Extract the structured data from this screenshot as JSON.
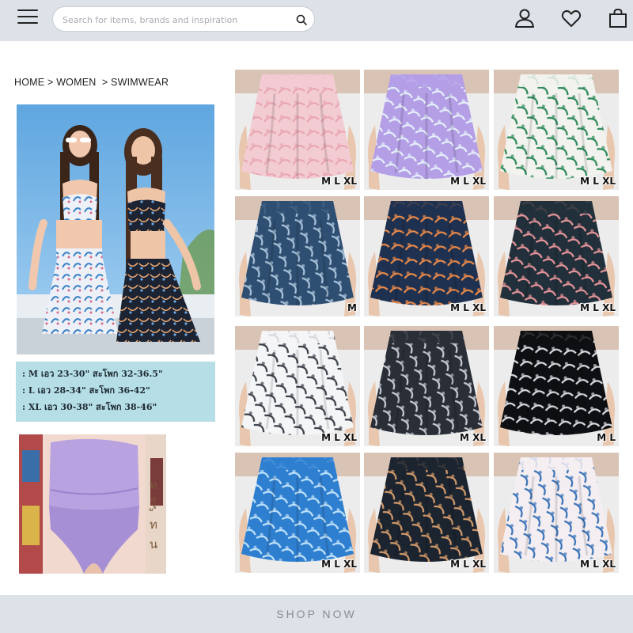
{
  "header": {
    "search_placeholder": "Search for items, brands and inspiration",
    "icons": [
      "menu-icon",
      "search-icon",
      "account-icon",
      "heart-icon",
      "bag-icon"
    ]
  },
  "breadcrumb": {
    "home": "HOME",
    "women": "WOMEN",
    "swimwear": "SWIMWEAR",
    "separator": ">"
  },
  "size_chart": [
    ": M  เอว 23-30\" สะโพก 32-36.5\"",
    ": L  เอว 28-34\" สะโพก 36-42\"",
    ": XL เอว 30-38\" สะโพก 38-46\""
  ],
  "detail_caption": "ทูโทน",
  "products": [
    {
      "sizes": "M L XL",
      "pattern": "pink-script-print",
      "colors": [
        "#f3cbd2",
        "#e9a7b3"
      ]
    },
    {
      "sizes": "M L XL",
      "pattern": "lavender-leaf-print",
      "colors": [
        "#b49ee6",
        "#e5f0fb"
      ]
    },
    {
      "sizes": "M L XL",
      "pattern": "pineapple-print",
      "colors": [
        "#f2f2ee",
        "#2e8a5a"
      ]
    },
    {
      "sizes": "M",
      "pattern": "navy-tie-dye",
      "colors": [
        "#2f4f72",
        "#a9c2da"
      ]
    },
    {
      "sizes": "M L XL",
      "pattern": "navy-tropical-leaf",
      "colors": [
        "#1f3150",
        "#e8894a"
      ]
    },
    {
      "sizes": "M L XL",
      "pattern": "dark-floral-palm",
      "colors": [
        "#21303a",
        "#e6949a"
      ]
    },
    {
      "sizes": "M L XL",
      "pattern": "white-marble",
      "colors": [
        "#f4f5f7",
        "#3a3f47"
      ]
    },
    {
      "sizes": "M  XL",
      "pattern": "grey-marble",
      "colors": [
        "#2a2e36",
        "#c5cad3"
      ]
    },
    {
      "sizes": "M L",
      "pattern": "black-marble",
      "colors": [
        "#0e0f12",
        "#d8dadf"
      ]
    },
    {
      "sizes": "M L XL",
      "pattern": "blue-tie-dye",
      "colors": [
        "#2f7fd0",
        "#bfe2fb"
      ]
    },
    {
      "sizes": "M L XL",
      "pattern": "navy-chain-print",
      "colors": [
        "#1c2430",
        "#d29a6a"
      ]
    },
    {
      "sizes": "M L XL",
      "pattern": "white-blue-chain",
      "colors": [
        "#f4eef2",
        "#3a73b8"
      ]
    }
  ],
  "footer": {
    "cta": "SHOP NOW"
  },
  "colors": {
    "chrome": "#dde1e8",
    "page": "#ffffff",
    "size_box": "#b6dee6"
  }
}
